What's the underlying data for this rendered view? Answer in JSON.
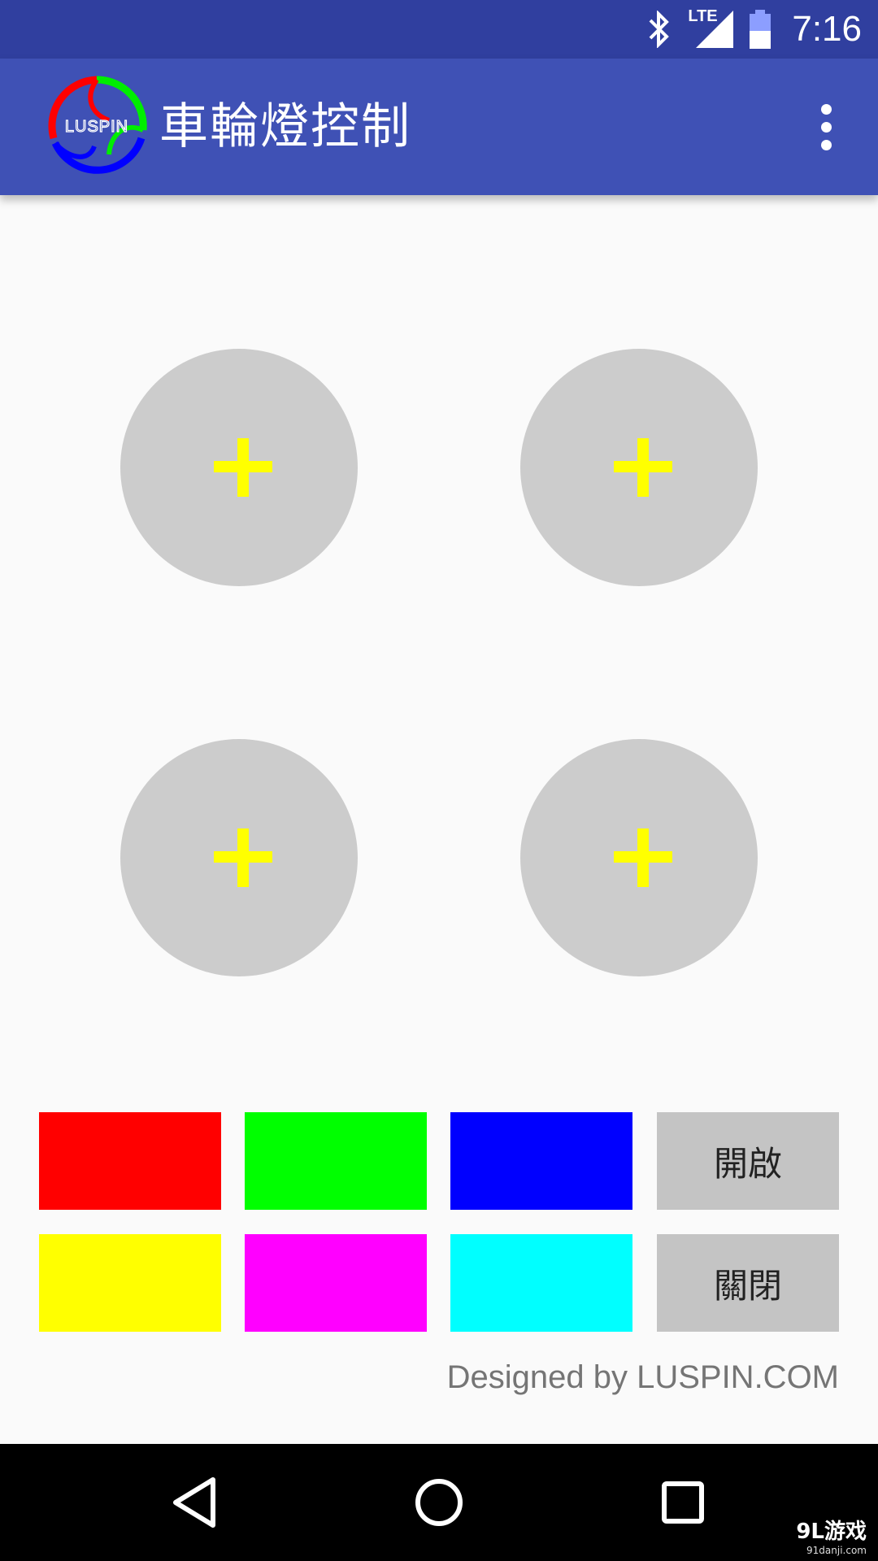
{
  "status_bar": {
    "network": "LTE",
    "time": "7:16",
    "icons": [
      "bluetooth-icon",
      "lte-signal-icon",
      "battery-icon"
    ]
  },
  "app_bar": {
    "logo_text": "LUSPIN",
    "title": "車輪燈控制",
    "menu_icon": "more-vert-icon"
  },
  "wheels": [
    {
      "icon": "plus-icon"
    },
    {
      "icon": "plus-icon"
    },
    {
      "icon": "plus-icon"
    },
    {
      "icon": "plus-icon"
    }
  ],
  "colors": {
    "red": "#ff0000",
    "green": "#00ff00",
    "blue": "#0000ff",
    "yellow": "#ffff00",
    "magenta": "#ff00ff",
    "cyan": "#00ffff",
    "accent": "#3f51b5",
    "status_bar": "#303f9f",
    "wheel": "#cccccc"
  },
  "controls": {
    "on_label": "開啟",
    "off_label": "關閉"
  },
  "footer": {
    "credit": "Designed by LUSPIN.COM"
  },
  "nav": {
    "back_icon": "back-triangle-icon",
    "home_icon": "home-circle-icon",
    "recents_icon": "recents-square-icon"
  },
  "watermark": {
    "main": "9L游戏",
    "sub": "91danji.com"
  }
}
